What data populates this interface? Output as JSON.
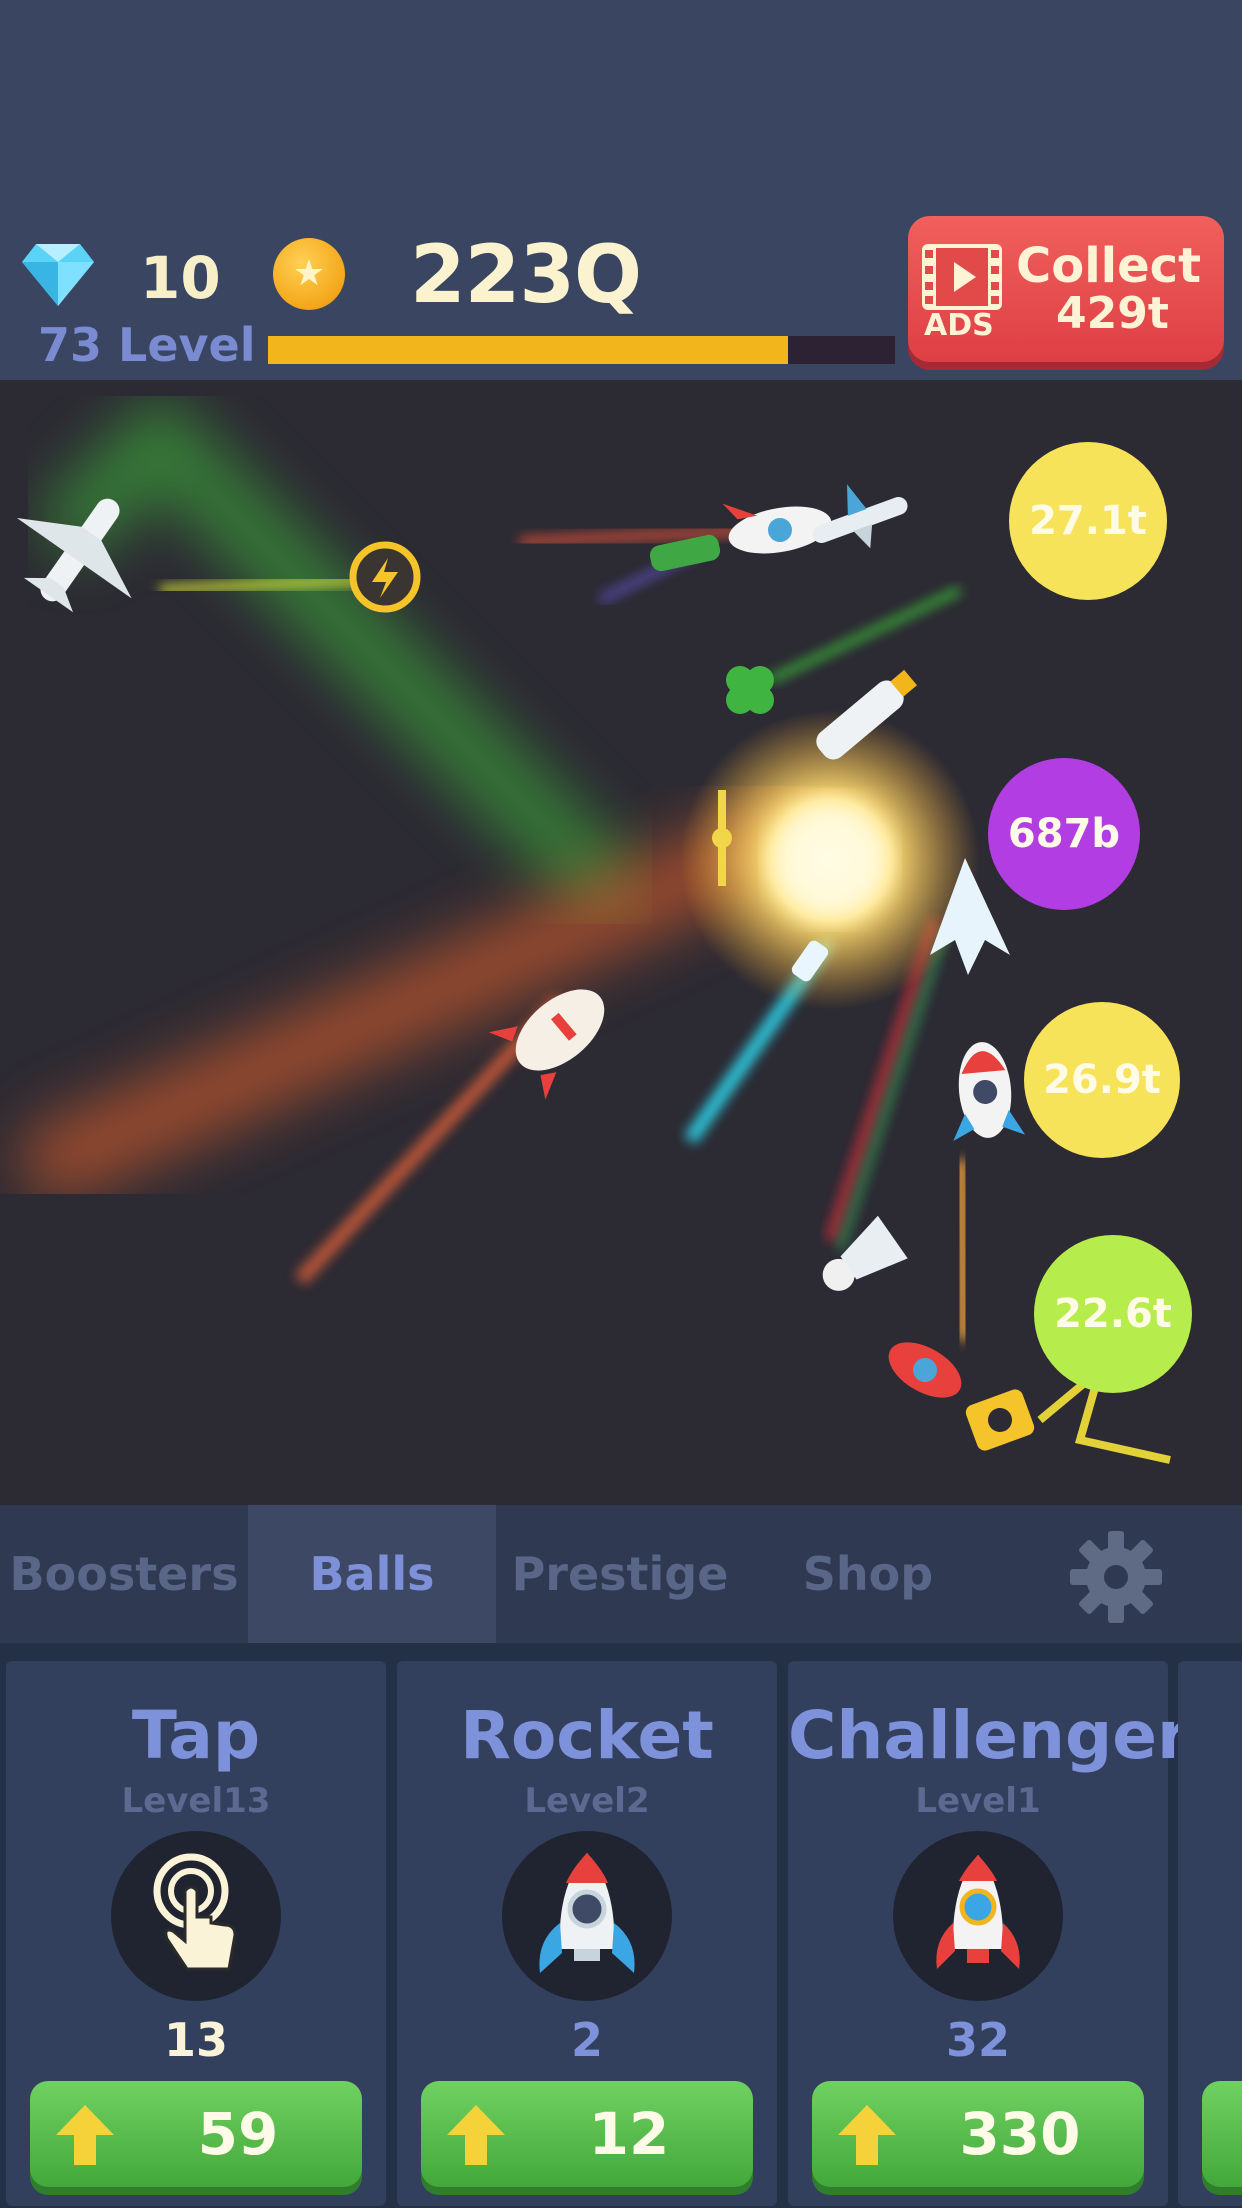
{
  "hud": {
    "gems": "10",
    "coins": "223Q",
    "level_label": "73 Level",
    "level_progress": 0.83,
    "collect": {
      "ads_label": "ADS",
      "label": "Collect",
      "value": "429t"
    }
  },
  "targets": [
    {
      "value": "27.1t",
      "color": "#f7e35a"
    },
    {
      "value": "687b",
      "color": "#b23ee3"
    },
    {
      "value": "26.9t",
      "color": "#f7e35a"
    },
    {
      "value": "22.6t",
      "color": "#b6ec4b"
    }
  ],
  "tabs": [
    {
      "label": "Boosters",
      "active": false
    },
    {
      "label": "Balls",
      "active": true
    },
    {
      "label": "Prestige",
      "active": false
    },
    {
      "label": "Shop",
      "active": false
    }
  ],
  "cards": [
    {
      "title": "Tap",
      "level": "Level13",
      "count": "13",
      "count_color": "#fbf3d8",
      "cost": "59",
      "icon": "tap-hand-icon"
    },
    {
      "title": "Rocket",
      "level": "Level2",
      "count": "2",
      "count_color": "#7e92db",
      "cost": "12",
      "icon": "rocket-icon"
    },
    {
      "title": "Challenger",
      "level": "Level1",
      "count": "32",
      "count_color": "#7e92db",
      "cost": "330",
      "icon": "challenger-rocket-icon"
    }
  ],
  "colors": {
    "gold": "#f2b51c",
    "green": "#4db543",
    "red": "#e44a4c",
    "accent": "#7e92db"
  }
}
